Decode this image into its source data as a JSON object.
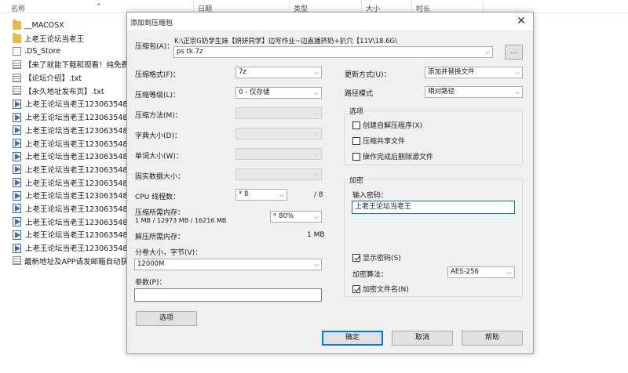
{
  "explorer": {
    "columns": {
      "name": "名称",
      "date": "日期",
      "type": "类型",
      "size": "大小",
      "duration": "时长"
    },
    "files": [
      {
        "icon": "folder-icon",
        "kind": "folder",
        "name": "__MACOSX"
      },
      {
        "icon": "folder-icon",
        "kind": "folder",
        "name": "上老王论坛当老王"
      },
      {
        "icon": "file-icon",
        "kind": "doc",
        "name": ".DS_Store"
      },
      {
        "icon": "text-file-icon",
        "kind": "txt",
        "name": "【来了就能下载和观看！纯免费"
      },
      {
        "icon": "text-file-icon",
        "kind": "txt",
        "name": "【论坛介绍】.txt"
      },
      {
        "icon": "text-file-icon",
        "kind": "txt",
        "name": "【永久地址发布页】.txt"
      },
      {
        "icon": "video-file-icon",
        "kind": "video",
        "name": "上老王论坛当老王1230635484"
      },
      {
        "icon": "video-file-icon",
        "kind": "video",
        "name": "上老王论坛当老王1230635484"
      },
      {
        "icon": "video-file-icon",
        "kind": "video",
        "name": "上老王论坛当老王1230635484"
      },
      {
        "icon": "video-file-icon",
        "kind": "video",
        "name": "上老王论坛当老王1230635484"
      },
      {
        "icon": "video-file-icon",
        "kind": "video",
        "name": "上老王论坛当老王1230635484"
      },
      {
        "icon": "video-file-icon",
        "kind": "video",
        "name": "上老王论坛当老王1230635484"
      },
      {
        "icon": "video-file-icon",
        "kind": "video",
        "name": "上老王论坛当老王1230635484"
      },
      {
        "icon": "video-file-icon",
        "kind": "video",
        "name": "上老王论坛当老王1230635484"
      },
      {
        "icon": "video-file-icon",
        "kind": "video",
        "name": "上老王论坛当老王1230635484"
      },
      {
        "icon": "video-file-icon",
        "kind": "video",
        "name": "上老王论坛当老王1230635484"
      },
      {
        "icon": "video-file-icon",
        "kind": "video",
        "name": "上老王论坛当老王1230635484"
      },
      {
        "icon": "video-file-icon",
        "kind": "video",
        "name": "上老王论坛当老王1230635484"
      },
      {
        "icon": "text-file-icon",
        "kind": "txt",
        "name": "最新地址及APP请发邮箱自动获"
      }
    ]
  },
  "dialog": {
    "title": "添加到压缩包",
    "archive_label": "压缩包(A)：",
    "archive_path": "K:\\正宗G奶学生妹【妍妍同学】边写作业~边直播挤奶+扒穴【11V\\18.6G\\",
    "archive_name": "ps tk.7z",
    "browse_label": "...",
    "format_label": "压缩格式(F)：",
    "format_value": "7z",
    "level_label": "压缩等级(L)：",
    "level_value": "0 - 仅存储",
    "method_label": "压缩方法(M)：",
    "dict_label": "字典大小(D)：",
    "word_label": "单词大小(W)：",
    "solid_label": "固实数据大小：",
    "cpu_label": "CPU 线程数：",
    "cpu_value": "* 8",
    "cpu_total": "/ 8",
    "mem_comp_label": "压缩所需内存：",
    "mem_comp_detail": "1 MB / 12973 MB / 16216 MB",
    "mem_percent": "* 80%",
    "mem_decomp_label": "解压所需内存：",
    "mem_decomp_value": "1 MB",
    "split_label": "分卷大小，字节(V)：",
    "split_value": "12000M",
    "params_label": "参数(P)：",
    "params_value": "",
    "options_button": "选项",
    "update_label": "更新方式(U)：",
    "update_value": "添加并替换文件",
    "pathmode_label": "路径模式",
    "pathmode_value": "相对路径",
    "options_group": "选项",
    "opt_sfx": "创建自解压程序(X)",
    "opt_shared": "压缩共享文件",
    "opt_delete": "操作完成后删除源文件",
    "encrypt_group": "加密",
    "password_label": "输入密码：",
    "password_value": "上老王论坛当老王",
    "show_password": "显示密码(S)",
    "enc_method_label": "加密算法：",
    "enc_method_value": "AES-256",
    "encrypt_names": "加密文件名(N)",
    "ok_button": "确定",
    "cancel_button": "取消",
    "help_button": "帮助",
    "arrow_glyph": "⌵",
    "close_glyph": "✕"
  },
  "colors": {
    "accent": "#0078d7",
    "dialog_bg": "#f0f0f0",
    "folder": "#e9b94a"
  }
}
